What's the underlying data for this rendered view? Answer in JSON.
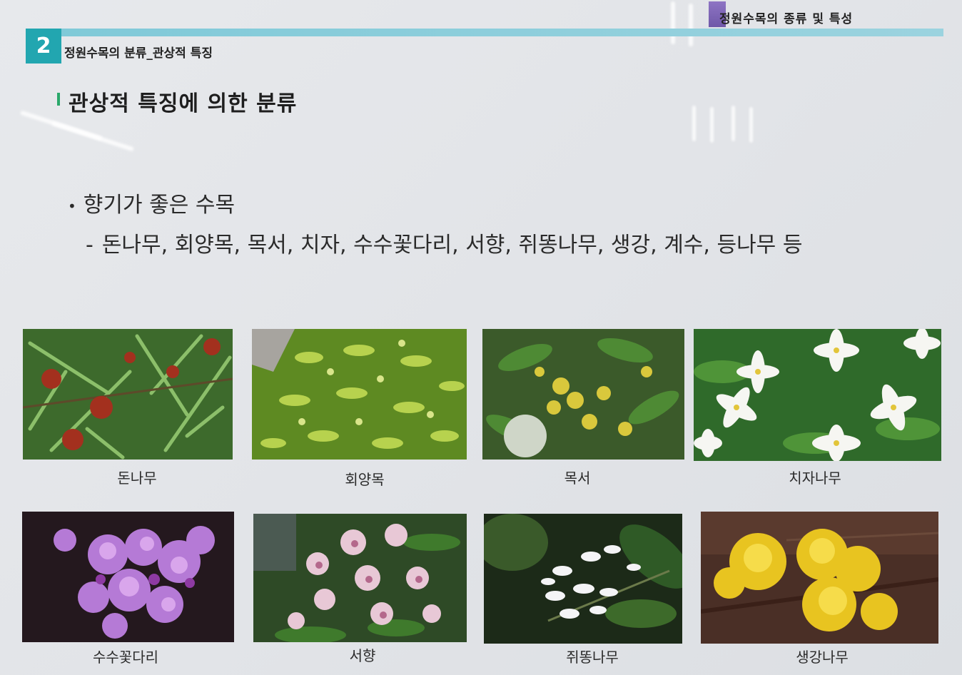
{
  "header": {
    "top_label": "정원수목의 종류 및 특성",
    "section_number": "2",
    "section_title": "정원수목의 분류_관상적 특징"
  },
  "content": {
    "heading": "관상적 특징에 의한 분류",
    "bullet": "향기가 좋은 수목",
    "dash": "-",
    "species_line": "돈나무, 회양목, 목서, 치자, 수수꽃다리, 서향,  쥐똥나무, 생강, 계수, 등나무 등"
  },
  "gallery": {
    "captions": [
      "돈나무",
      "회양목",
      "목서",
      "치자나무",
      "수수꽃다리",
      "서향",
      "쥐똥나무",
      "생강나무"
    ]
  },
  "colors": {
    "accent_teal": "#22a6b0",
    "accent_line": "#7fc9d8",
    "accent_purple": "#7a62b4",
    "heading_mark": "#2aa86a"
  }
}
